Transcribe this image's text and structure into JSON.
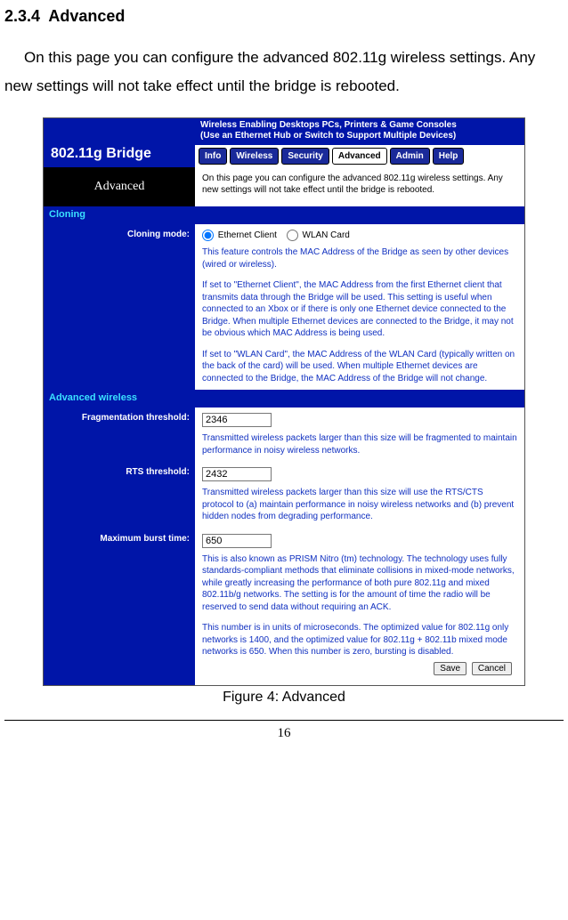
{
  "doc": {
    "section_number": "2.3.4",
    "section_title": "Advanced",
    "intro": "On this page you can configure the advanced 802.11g wireless settings. Any new settings will not take effect until the bridge is rebooted.",
    "figure_caption": "Figure 4: Advanced",
    "page_number": "16"
  },
  "ui": {
    "logo": "802.11g Bridge",
    "banner_line1": "Wireless Enabling Desktops PCs, Printers & Game Consoles",
    "banner_line2": "(Use an Ethernet Hub or Switch to Support Multiple Devices)",
    "tabs": {
      "info": "Info",
      "wireless": "Wireless",
      "security": "Security",
      "advanced": "Advanced",
      "admin": "Admin",
      "help": "Help"
    },
    "page_name": "Advanced",
    "page_intro": "On this page you can configure the advanced 802.11g wireless settings. Any new settings will not take effect until the bridge is rebooted.",
    "sections": {
      "cloning": {
        "header": "Cloning",
        "mode_label": "Cloning mode:",
        "opt_ethernet": "Ethernet Client",
        "opt_wlan": "WLAN Card",
        "desc1": "This feature controls the MAC Address of the Bridge as seen by other devices (wired or wireless).",
        "desc2": "If set to \"Ethernet Client\", the MAC Address from the first Ethernet client that transmits data through the Bridge will be used. This setting is useful when connected to an Xbox or if there is only one Ethernet device connected to the Bridge. When multiple Ethernet devices are connected to the Bridge, it may not be obvious which MAC Address is being used.",
        "desc3": "If set to \"WLAN Card\", the MAC Address of the WLAN Card (typically written on the back of the card) will be used. When multiple Ethernet devices are connected to the Bridge, the MAC Address of the Bridge will not change."
      },
      "advanced_wireless": {
        "header": "Advanced wireless",
        "frag_label": "Fragmentation threshold:",
        "frag_value": "2346",
        "frag_desc": "Transmitted wireless packets larger than this size will be fragmented to maintain performance in noisy wireless networks.",
        "rts_label": "RTS threshold:",
        "rts_value": "2432",
        "rts_desc": "Transmitted wireless packets larger than this size will use the RTS/CTS protocol to (a) maintain performance in noisy wireless networks and (b) prevent hidden nodes from degrading performance.",
        "burst_label": "Maximum burst time:",
        "burst_value": "650",
        "burst_desc1": "This is also known as PRISM Nitro (tm) technology. The technology uses fully standards-compliant methods that eliminate collisions in mixed-mode networks, while greatly increasing the performance of both pure 802.11g and mixed 802.11b/g networks. The setting is for the amount of time the radio will be reserved to send data without requiring an ACK.",
        "burst_desc2": "This number is in units of microseconds. The optimized value for 802.11g only networks is 1400, and the optimized value for 802.11g + 802.11b mixed mode networks is 650. When this number is zero, bursting is disabled."
      }
    },
    "buttons": {
      "save": "Save",
      "cancel": "Cancel"
    }
  }
}
